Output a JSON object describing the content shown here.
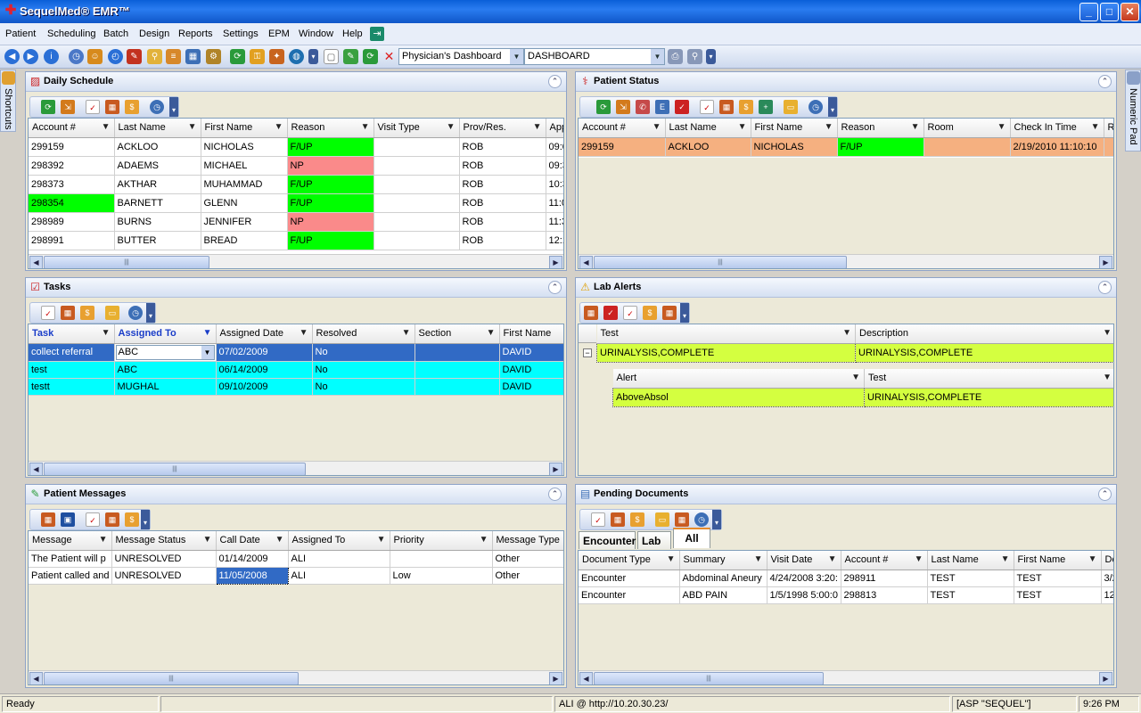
{
  "window": {
    "title": "SequelMed® EMR™",
    "min": "_",
    "max": "□",
    "close": "✕"
  },
  "menu": [
    "Patient",
    "Scheduling",
    "Batch",
    "Design",
    "Reports",
    "Settings",
    "EPM",
    "Window",
    "Help"
  ],
  "toolbar": {
    "dashboard_select": "Physician's Dashboard",
    "view_select": "DASHBOARD"
  },
  "side": {
    "left": "Shortcuts",
    "right": "Numeric Pad"
  },
  "daily_schedule": {
    "title": "Daily Schedule",
    "columns": [
      "Account #",
      "Last Name",
      "First Name",
      "Reason",
      "Visit Type",
      "Prov/Res.",
      "App"
    ],
    "rows": [
      [
        "299159",
        "ACKLOO",
        "NICHOLAS",
        "F/UP",
        "",
        "ROB",
        "09:0"
      ],
      [
        "298392",
        "ADAEMS",
        "MICHAEL",
        "NP",
        "",
        "ROB",
        "09:3"
      ],
      [
        "298373",
        "AKTHAR",
        "MUHAMMAD",
        "F/UP",
        "",
        "ROB",
        "10:3"
      ],
      [
        "298354",
        "BARNETT",
        "GLENN",
        "F/UP",
        "",
        "ROB",
        "11:0"
      ],
      [
        "298989",
        "BURNS",
        "JENNIFER",
        "NP",
        "",
        "ROB",
        "11:3"
      ],
      [
        "298991",
        "BUTTER",
        "BREAD",
        "F/UP",
        "",
        "ROB",
        "12:1"
      ]
    ]
  },
  "patient_status": {
    "title": "Patient Status",
    "columns": [
      "Account #",
      "Last Name",
      "First Name",
      "Reason",
      "Room",
      "Check In Time",
      "R"
    ],
    "rows": [
      [
        "299159",
        "ACKLOO",
        "NICHOLAS",
        "F/UP",
        "",
        "2/19/2010 11:10:10",
        ""
      ]
    ]
  },
  "tasks": {
    "title": "Tasks",
    "columns": [
      "Task",
      "Assigned To",
      "Assigned Date",
      "Resolved",
      "Section",
      "First Name"
    ],
    "rows": [
      [
        "collect referral",
        "ABC",
        "07/02/2009",
        "No",
        "",
        "DAVID"
      ],
      [
        "test",
        "ABC",
        "06/14/2009",
        "No",
        "",
        "DAVID"
      ],
      [
        "testt",
        "MUGHAL",
        "09/10/2009",
        "No",
        "",
        "DAVID"
      ]
    ]
  },
  "lab_alerts": {
    "title": "Lab Alerts",
    "columns": [
      "Test",
      "Description"
    ],
    "row": [
      "URINALYSIS,COMPLETE",
      "URINALYSIS,COMPLETE"
    ],
    "sub_columns": [
      "Alert",
      "Test"
    ],
    "sub_row": [
      "AboveAbsol",
      "URINALYSIS,COMPLETE"
    ],
    "expander": "−"
  },
  "patient_messages": {
    "title": "Patient Messages",
    "columns": [
      "Message",
      "Message Status",
      "Call Date",
      "Assigned To",
      "Priority",
      "Message Type"
    ],
    "rows": [
      [
        "The Patient will p",
        "UNRESOLVED",
        "01/14/2009",
        "ALI",
        "",
        "Other"
      ],
      [
        "Patient called and",
        "UNRESOLVED",
        "11/05/2008",
        "ALI",
        "Low",
        "Other"
      ]
    ]
  },
  "pending_documents": {
    "title": "Pending Documents",
    "tabs": [
      "Encounter",
      "Lab",
      "All"
    ],
    "columns": [
      "Document Type",
      "Summary",
      "Visit Date",
      "Account #",
      "Last Name",
      "First Name",
      "Do"
    ],
    "rows": [
      [
        "Encounter",
        "Abdominal Aneury",
        "4/24/2008 3:20:",
        "298911",
        "TEST",
        "TEST",
        "3/2"
      ],
      [
        "Encounter",
        "ABD PAIN",
        "1/5/1998 5:00:0",
        "298813",
        "TEST",
        "TEST",
        "12"
      ]
    ]
  },
  "statusbar": {
    "state": "Ready",
    "server": "ALI @ http://10.20.30.23/",
    "asp": "[ASP \"SEQUEL\"]",
    "time": "9:26 PM"
  }
}
